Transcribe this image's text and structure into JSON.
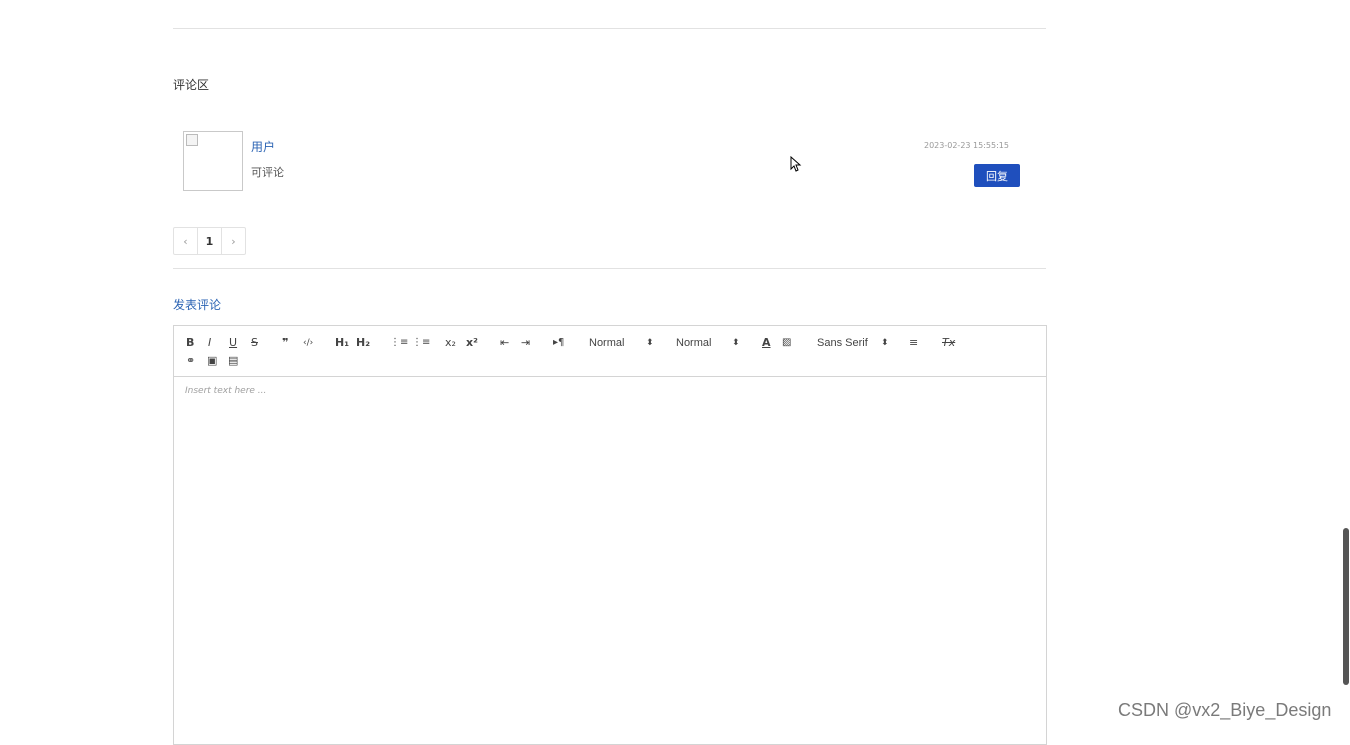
{
  "comments": {
    "section_title": "评论区",
    "items": [
      {
        "user": "用户",
        "content": "可评论",
        "time": "2023-02-23 15:55:15",
        "reply_label": "回复"
      }
    ]
  },
  "pagination": {
    "prev": "‹",
    "current": "1",
    "next": "›"
  },
  "post_comment": {
    "title": "发表评论"
  },
  "editor": {
    "placeholder": "Insert text here ...",
    "toolbar": {
      "bold": "B",
      "italic": "I",
      "underline": "U",
      "strike": "S",
      "blockquote": "❞",
      "code": "‹/›",
      "h1": "H₁",
      "h2": "H₂",
      "ordered_list": "⋮≡",
      "bullet_list": "⋮≡",
      "subscript": "x₂",
      "superscript": "x²",
      "outdent": "⇤",
      "indent": "⇥",
      "direction": "▸¶",
      "size_select": "Normal",
      "header_select": "Normal",
      "color": "A",
      "background": "▨",
      "font_select": "Sans Serif",
      "align": "≡",
      "clean": "Tx",
      "link": "⚭",
      "image": "▣",
      "video": "▤"
    }
  },
  "watermark": "CSDN @vx2_Biye_Design"
}
